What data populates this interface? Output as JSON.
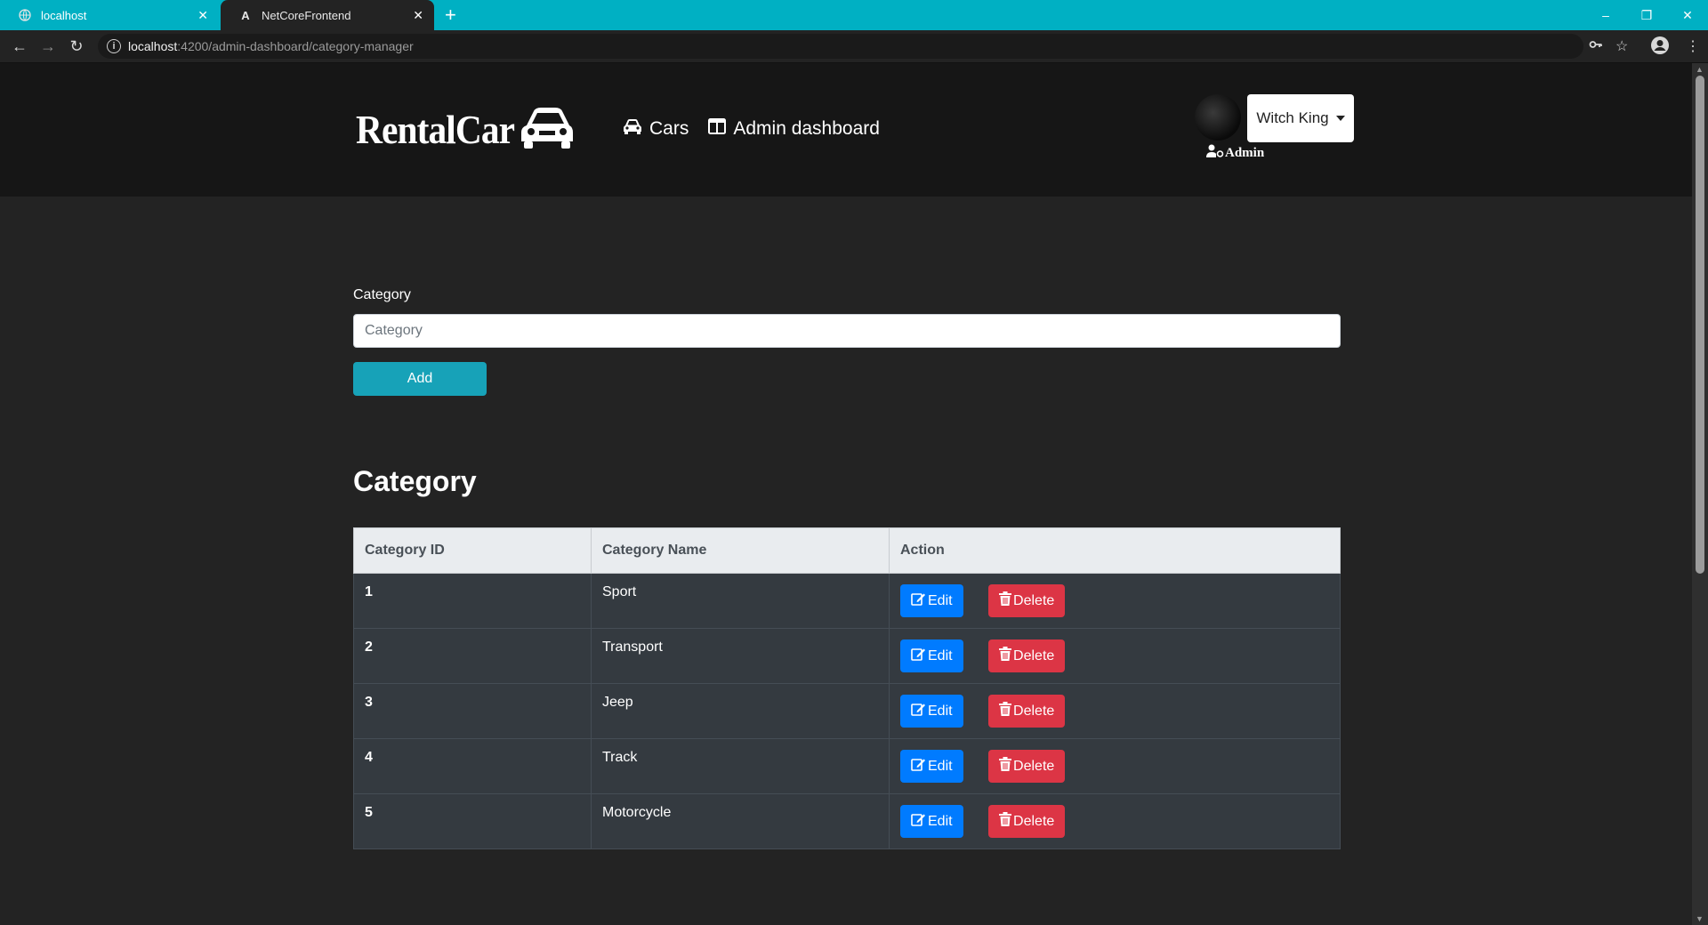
{
  "browser": {
    "tabs": [
      {
        "title": "localhost",
        "favicon": "globe-icon"
      },
      {
        "title": "NetCoreFrontend",
        "favicon": "angular-icon"
      }
    ],
    "url_host": "localhost",
    "url_path": ":4200/admin-dashboard/category-manager"
  },
  "header": {
    "logo_text": "RentalCar",
    "nav": [
      {
        "label": "Cars",
        "icon": "car-icon"
      },
      {
        "label": "Admin dashboard",
        "icon": "columns-icon"
      }
    ],
    "user": {
      "name": "Witch King",
      "role": "Admin"
    }
  },
  "form": {
    "label": "Category",
    "placeholder": "Category",
    "value": "",
    "add_label": "Add"
  },
  "table": {
    "title": "Category",
    "headers": [
      "Category ID",
      "Category Name",
      "Action"
    ],
    "rows": [
      {
        "id": "1",
        "name": "Sport"
      },
      {
        "id": "2",
        "name": "Transport"
      },
      {
        "id": "3",
        "name": "Jeep"
      },
      {
        "id": "4",
        "name": "Track"
      },
      {
        "id": "5",
        "name": "Motorcycle"
      }
    ],
    "edit_label": "Edit",
    "delete_label": "Delete"
  },
  "colors": {
    "chrome": "#00b0c3",
    "header_bg": "#161616",
    "page_bg": "#232323",
    "add_button": "#17a2b8",
    "edit_button": "#007bff",
    "delete_button": "#dc3545"
  }
}
